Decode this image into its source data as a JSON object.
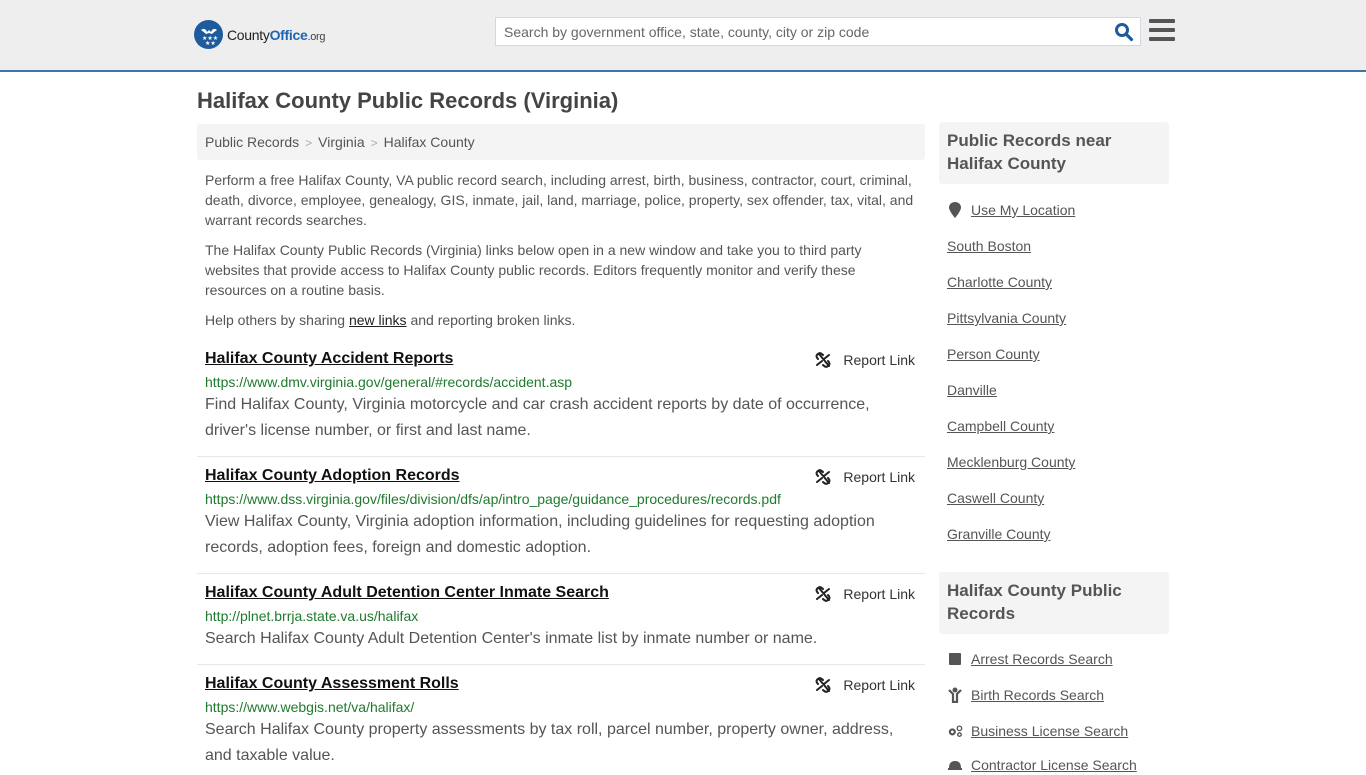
{
  "header": {
    "logo": {
      "part1": "County",
      "part2": "Office",
      "part3": ".org"
    },
    "search": {
      "placeholder": "Search by government office, state, county, city or zip code",
      "value": ""
    },
    "search_icon": "search-icon",
    "menu_icon": "hamburger-menu-icon"
  },
  "page": {
    "title": "Halifax County Public Records (Virginia)"
  },
  "breadcrumb": [
    {
      "label": "Public Records"
    },
    {
      "label": "Virginia"
    },
    {
      "label": "Halifax County"
    }
  ],
  "intro": {
    "p1": "Perform a free Halifax County, VA public record search, including arrest, birth, business, contractor, court, criminal, death, divorce, employee, genealogy, GIS, inmate, jail, land, marriage, police, property, sex offender, tax, vital, and warrant records searches.",
    "p2": "The Halifax County Public Records (Virginia) links below open in a new window and take you to third party websites that provide access to Halifax County public records. Editors frequently monitor and verify these resources on a routine basis.",
    "p3_before": "Help others by sharing ",
    "p3_link": "new links",
    "p3_after": " and reporting broken links."
  },
  "records": [
    {
      "title": "Halifax County Accident Reports",
      "url": "https://www.dmv.virginia.gov/general/#records/accident.asp",
      "description": "Find Halifax County, Virginia motorcycle and car crash accident reports by date of occurrence, driver's license number, or first and last name.",
      "report_label": "Report Link"
    },
    {
      "title": "Halifax County Adoption Records",
      "url": "https://www.dss.virginia.gov/files/division/dfs/ap/intro_page/guidance_procedures/records.pdf",
      "description": "View Halifax County, Virginia adoption information, including guidelines for requesting adoption records, adoption fees, foreign and domestic adoption.",
      "report_label": "Report Link"
    },
    {
      "title": "Halifax County Adult Detention Center Inmate Search",
      "url": "http://plnet.brrja.state.va.us/halifax",
      "description": "Search Halifax County Adult Detention Center's inmate list by inmate number or name.",
      "report_label": "Report Link"
    },
    {
      "title": "Halifax County Assessment Rolls",
      "url": "https://www.webgis.net/va/halifax/",
      "description": "Search Halifax County property assessments by tax roll, parcel number, property owner, address, and taxable value.",
      "report_label": "Report Link"
    }
  ],
  "sidebar": {
    "nearby_title": "Public Records near Halifax County",
    "use_location": "Use My Location",
    "nearby": [
      "South Boston",
      "Charlotte County",
      "Pittsylvania County",
      "Person County",
      "Danville",
      "Campbell County",
      "Mecklenburg County",
      "Caswell County",
      "Granville County"
    ],
    "records_title": "Halifax County Public Records",
    "record_links": [
      {
        "label": "Arrest Records Search",
        "icon": "handcuffs-icon"
      },
      {
        "label": "Birth Records Search",
        "icon": "baby-icon"
      },
      {
        "label": "Business License Search",
        "icon": "gears-icon"
      },
      {
        "label": "Contractor License Search",
        "icon": "hard-hat-icon"
      }
    ]
  },
  "colors": {
    "header_bg": "#eeeeee",
    "header_border": "#3b76a8",
    "brand_blue": "#1d66b2",
    "url_green": "#1f7a2d",
    "panel_bg": "#f4f4f4"
  }
}
